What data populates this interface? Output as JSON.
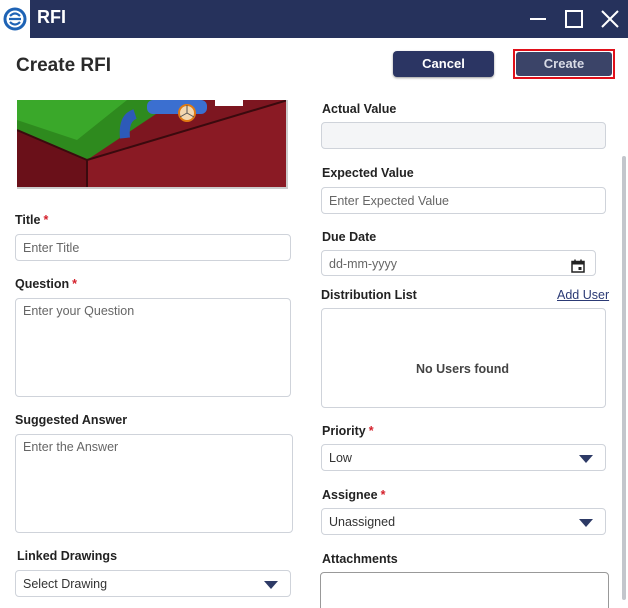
{
  "window": {
    "title": "RFI"
  },
  "header": {
    "title": "Create RFI",
    "cancel_label": "Cancel",
    "create_label": "Create"
  },
  "left": {
    "title_label": "Title",
    "title_placeholder": "Enter Title",
    "question_label": "Question",
    "question_placeholder": "Enter your Question",
    "suggested_label": "Suggested Answer",
    "suggested_placeholder": "Enter the Answer",
    "linked_label": "Linked Drawings",
    "linked_value": "Select Drawing"
  },
  "right": {
    "actual_label": "Actual Value",
    "actual_value": "",
    "expected_label": "Expected Value",
    "expected_placeholder": "Enter Expected Value",
    "due_label": "Due Date",
    "due_placeholder": "dd-mm-yyyy",
    "distribution_label": "Distribution List",
    "add_user_label": "Add User",
    "no_users_text": "No Users found",
    "priority_label": "Priority",
    "priority_value": "Low",
    "assignee_label": "Assignee",
    "assignee_value": "Unassigned",
    "attachments_label": "Attachments"
  },
  "required_mark": "*",
  "colors": {
    "titlebar": "#26325c",
    "button": "#2b3563",
    "required": "#d4202b",
    "highlight": "#e0101a"
  },
  "icons": [
    "app-logo-icon",
    "minimize-icon",
    "maximize-icon",
    "close-icon",
    "calendar-icon",
    "chevron-down-icon"
  ]
}
